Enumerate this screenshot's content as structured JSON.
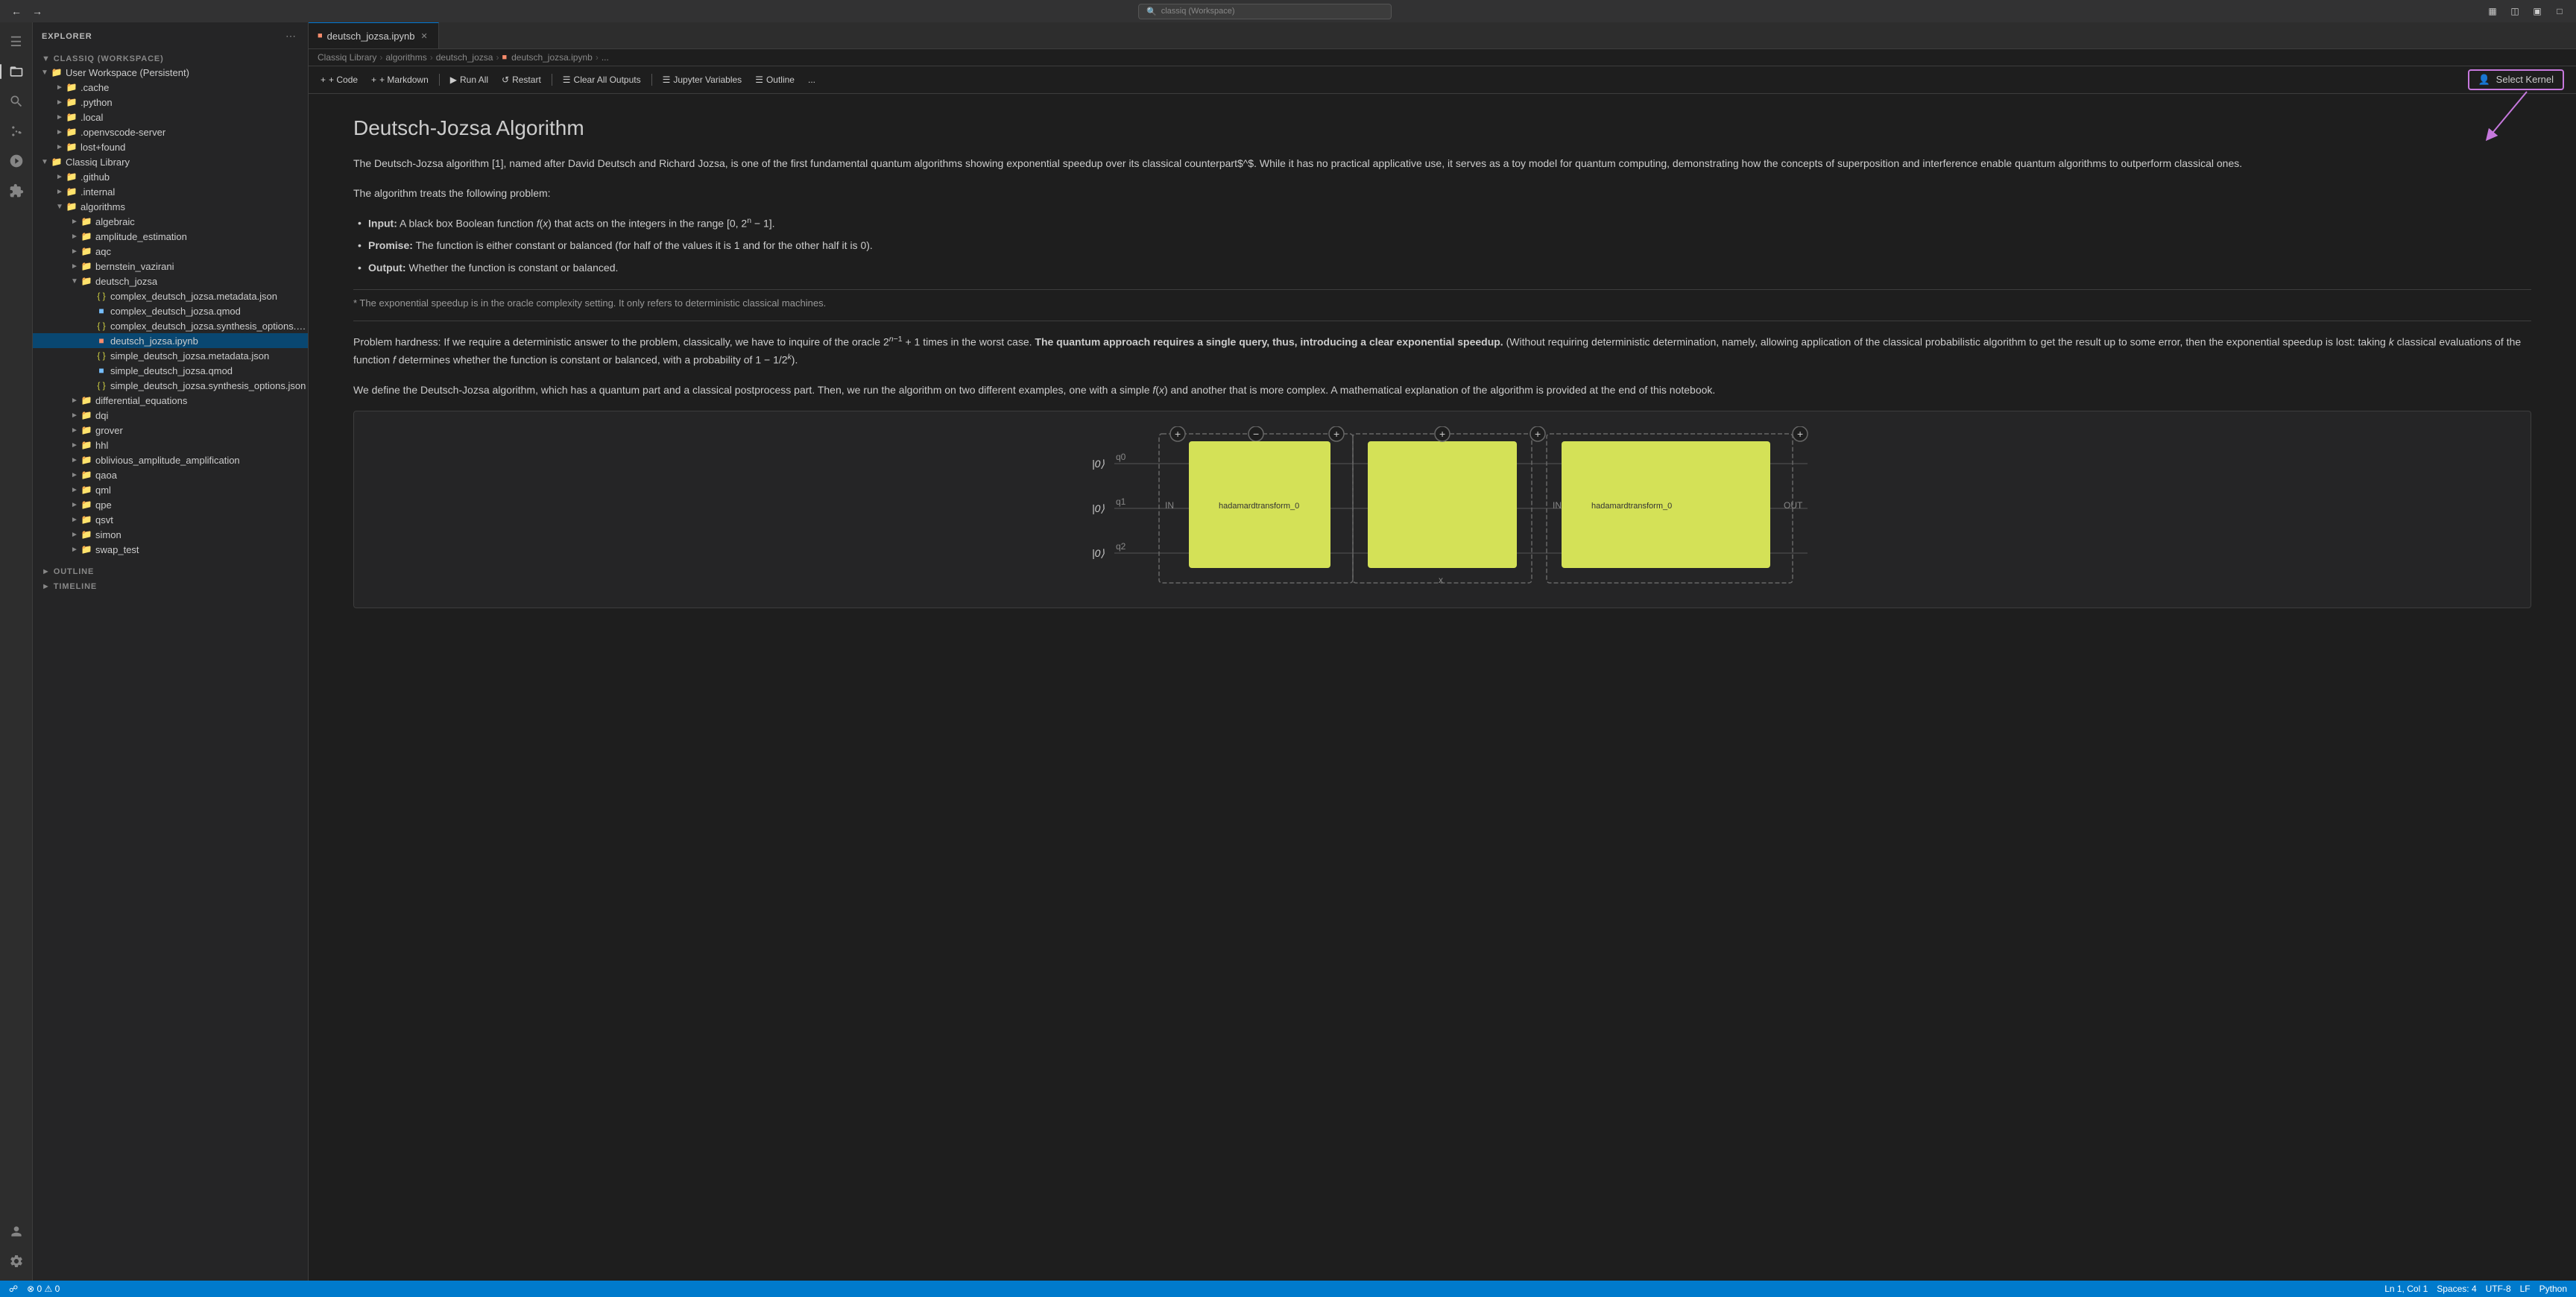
{
  "app": {
    "title": "classiq (Workspace)",
    "tab_file": "deutsch_jozsa.ipynb",
    "window_controls": [
      "layout-icon",
      "sidebar-icon",
      "panel-icon",
      "maximize-icon"
    ]
  },
  "breadcrumb": {
    "items": [
      "Classiq Library",
      "algorithms",
      "deutsch_jozsa",
      "deutsch_jozsa.ipynb",
      "..."
    ]
  },
  "toolbar": {
    "code_label": "+ Code",
    "markdown_label": "+ Markdown",
    "run_all_label": "▶ Run All",
    "restart_label": "↺ Restart",
    "clear_all_outputs_label": "Clear All Outputs",
    "jupyter_variables_label": "Jupyter Variables",
    "outline_label": "Outline",
    "more_label": "..."
  },
  "notebook": {
    "title": "Deutsch-Jozsa Algorithm",
    "intro_paragraph": "The Deutsch-Jozsa algorithm [1], named after David Deutsch and Richard Jozsa, is one of the first fundamental quantum algorithms showing exponential speedup over its classical counterpart$^$. While it has no practical applicative use, it serves as a toy model for quantum computing, demonstrating how the concepts of superposition and interference enable quantum algorithms to outperform classical ones.",
    "problem_intro": "The algorithm treats the following problem:",
    "input_label": "Input:",
    "input_text": "A black box Boolean function f(x) that acts on the integers in the range [0, 2^n − 1].",
    "promise_label": "Promise:",
    "promise_text": "The function is either constant or balanced (for half of the values it is 1 and for the other half it is 0).",
    "output_label": "Output:",
    "output_text": "Whether the function is constant or balanced.",
    "footnote": "* The exponential speedup is in the oracle complexity setting. It only refers to deterministic classical machines.",
    "hardness_text": "Problem hardness: If we require a deterministic answer to the problem, classically, we have to inquire of the oracle 2^(n−1) + 1 times in the worst case. The quantum approach requires a single query, thus, introducing a clear exponential speedup. (Without requiring deterministic determination, namely, allowing application of the classical probabilistic algorithm to get the result up to some error, then the exponential speedup is lost: taking k classical evaluations of the function f determines whether the function is constant or balanced, with a probability of 1 − 1/2^k).",
    "define_text": "We define the Deutsch-Jozsa algorithm, which has a quantum part and a classical postprocess part. Then, we run the algorithm on two different examples, one with a simple f(x) and another that is more complex. A mathematical explanation of the algorithm is provided at the end of this notebook.",
    "circuit_labels": {
      "q0": "q0",
      "q1": "q1",
      "q2": "q2",
      "ket0": "|0⟩",
      "hadamard1": "hadamardtransform_0",
      "hadamard2": "hadamardtransform_0",
      "IN": "IN",
      "OUT": "OUT",
      "x": "x"
    }
  },
  "sidebar": {
    "workspace_label": "CLASSIQ (WORKSPACE)",
    "explorer_label": "EXPLORER",
    "items": [
      {
        "label": "User Workspace (Persistent)",
        "type": "folder",
        "expanded": true,
        "indent": 0
      },
      {
        "label": ".cache",
        "type": "folder",
        "expanded": false,
        "indent": 1
      },
      {
        "label": ".python",
        "type": "folder",
        "expanded": false,
        "indent": 1
      },
      {
        "label": ".local",
        "type": "folder",
        "expanded": false,
        "indent": 1
      },
      {
        "label": ".openvscode-server",
        "type": "folder",
        "expanded": false,
        "indent": 1
      },
      {
        "label": "lost+found",
        "type": "folder",
        "expanded": false,
        "indent": 1
      },
      {
        "label": "Classiq Library",
        "type": "folder",
        "expanded": true,
        "indent": 0
      },
      {
        "label": ".github",
        "type": "folder",
        "expanded": false,
        "indent": 1
      },
      {
        "label": ".internal",
        "type": "folder",
        "expanded": false,
        "indent": 1
      },
      {
        "label": "algorithms",
        "type": "folder",
        "expanded": true,
        "indent": 1
      },
      {
        "label": "algebraic",
        "type": "folder",
        "expanded": false,
        "indent": 2
      },
      {
        "label": "amplitude_estimation",
        "type": "folder",
        "expanded": false,
        "indent": 2
      },
      {
        "label": "aqc",
        "type": "folder",
        "expanded": false,
        "indent": 2
      },
      {
        "label": "bernstein_vazirani",
        "type": "folder",
        "expanded": false,
        "indent": 2
      },
      {
        "label": "deutsch_jozsa",
        "type": "folder",
        "expanded": true,
        "indent": 2
      },
      {
        "label": "complex_deutsch_jozsa.metadata.json",
        "type": "json",
        "indent": 3
      },
      {
        "label": "complex_deutsch_jozsa.qmod",
        "type": "qmod",
        "indent": 3
      },
      {
        "label": "complex_deutsch_jozsa.synthesis_options.json",
        "type": "json",
        "indent": 3
      },
      {
        "label": "deutsch_jozsa.ipynb",
        "type": "ipynb",
        "indent": 3,
        "selected": true
      },
      {
        "label": "simple_deutsch_jozsa.metadata.json",
        "type": "json",
        "indent": 3
      },
      {
        "label": "simple_deutsch_jozsa.qmod",
        "type": "qmod",
        "indent": 3
      },
      {
        "label": "simple_deutsch_jozsa.synthesis_options.json",
        "type": "json",
        "indent": 3
      },
      {
        "label": "differential_equations",
        "type": "folder",
        "expanded": false,
        "indent": 2
      },
      {
        "label": "dqi",
        "type": "folder",
        "expanded": false,
        "indent": 2
      },
      {
        "label": "grover",
        "type": "folder",
        "expanded": false,
        "indent": 2
      },
      {
        "label": "hhl",
        "type": "folder",
        "expanded": false,
        "indent": 2
      },
      {
        "label": "oblivious_amplitude_amplification",
        "type": "folder",
        "expanded": false,
        "indent": 2
      },
      {
        "label": "qaoa",
        "type": "folder",
        "expanded": false,
        "indent": 2
      },
      {
        "label": "qml",
        "type": "folder",
        "expanded": false,
        "indent": 2
      },
      {
        "label": "qpe",
        "type": "folder",
        "expanded": false,
        "indent": 2
      },
      {
        "label": "qsvt",
        "type": "folder",
        "expanded": false,
        "indent": 2
      },
      {
        "label": "simon",
        "type": "folder",
        "expanded": false,
        "indent": 2
      },
      {
        "label": "swap_test",
        "type": "folder",
        "expanded": false,
        "indent": 2
      }
    ],
    "outline_section": "OUTLINE",
    "timeline_section": "TIMELINE"
  },
  "select_kernel": {
    "label": "Select Kernel"
  },
  "status_bar": {
    "git_branch": "",
    "errors": "0",
    "warnings": "0",
    "ln": "Ln 1",
    "col": "Col 1",
    "spaces": "Spaces: 4",
    "encoding": "UTF-8",
    "eol": "LF",
    "language": "Python"
  }
}
